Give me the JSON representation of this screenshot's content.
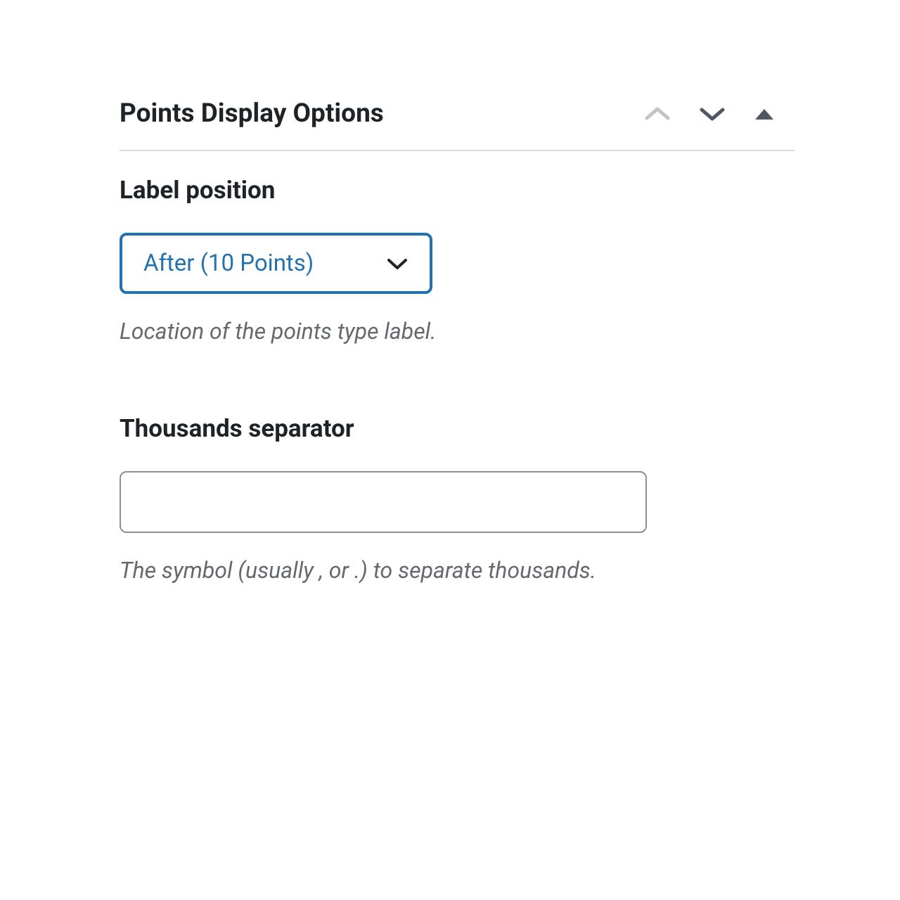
{
  "panel": {
    "title": "Points Display Options"
  },
  "fields": {
    "label_position": {
      "label": "Label position",
      "selected": "After (10 Points)",
      "description": "Location of the points type label."
    },
    "thousands_separator": {
      "label": "Thousands separator",
      "value": "",
      "description": "The symbol (usually , or .) to separate thousands."
    }
  }
}
